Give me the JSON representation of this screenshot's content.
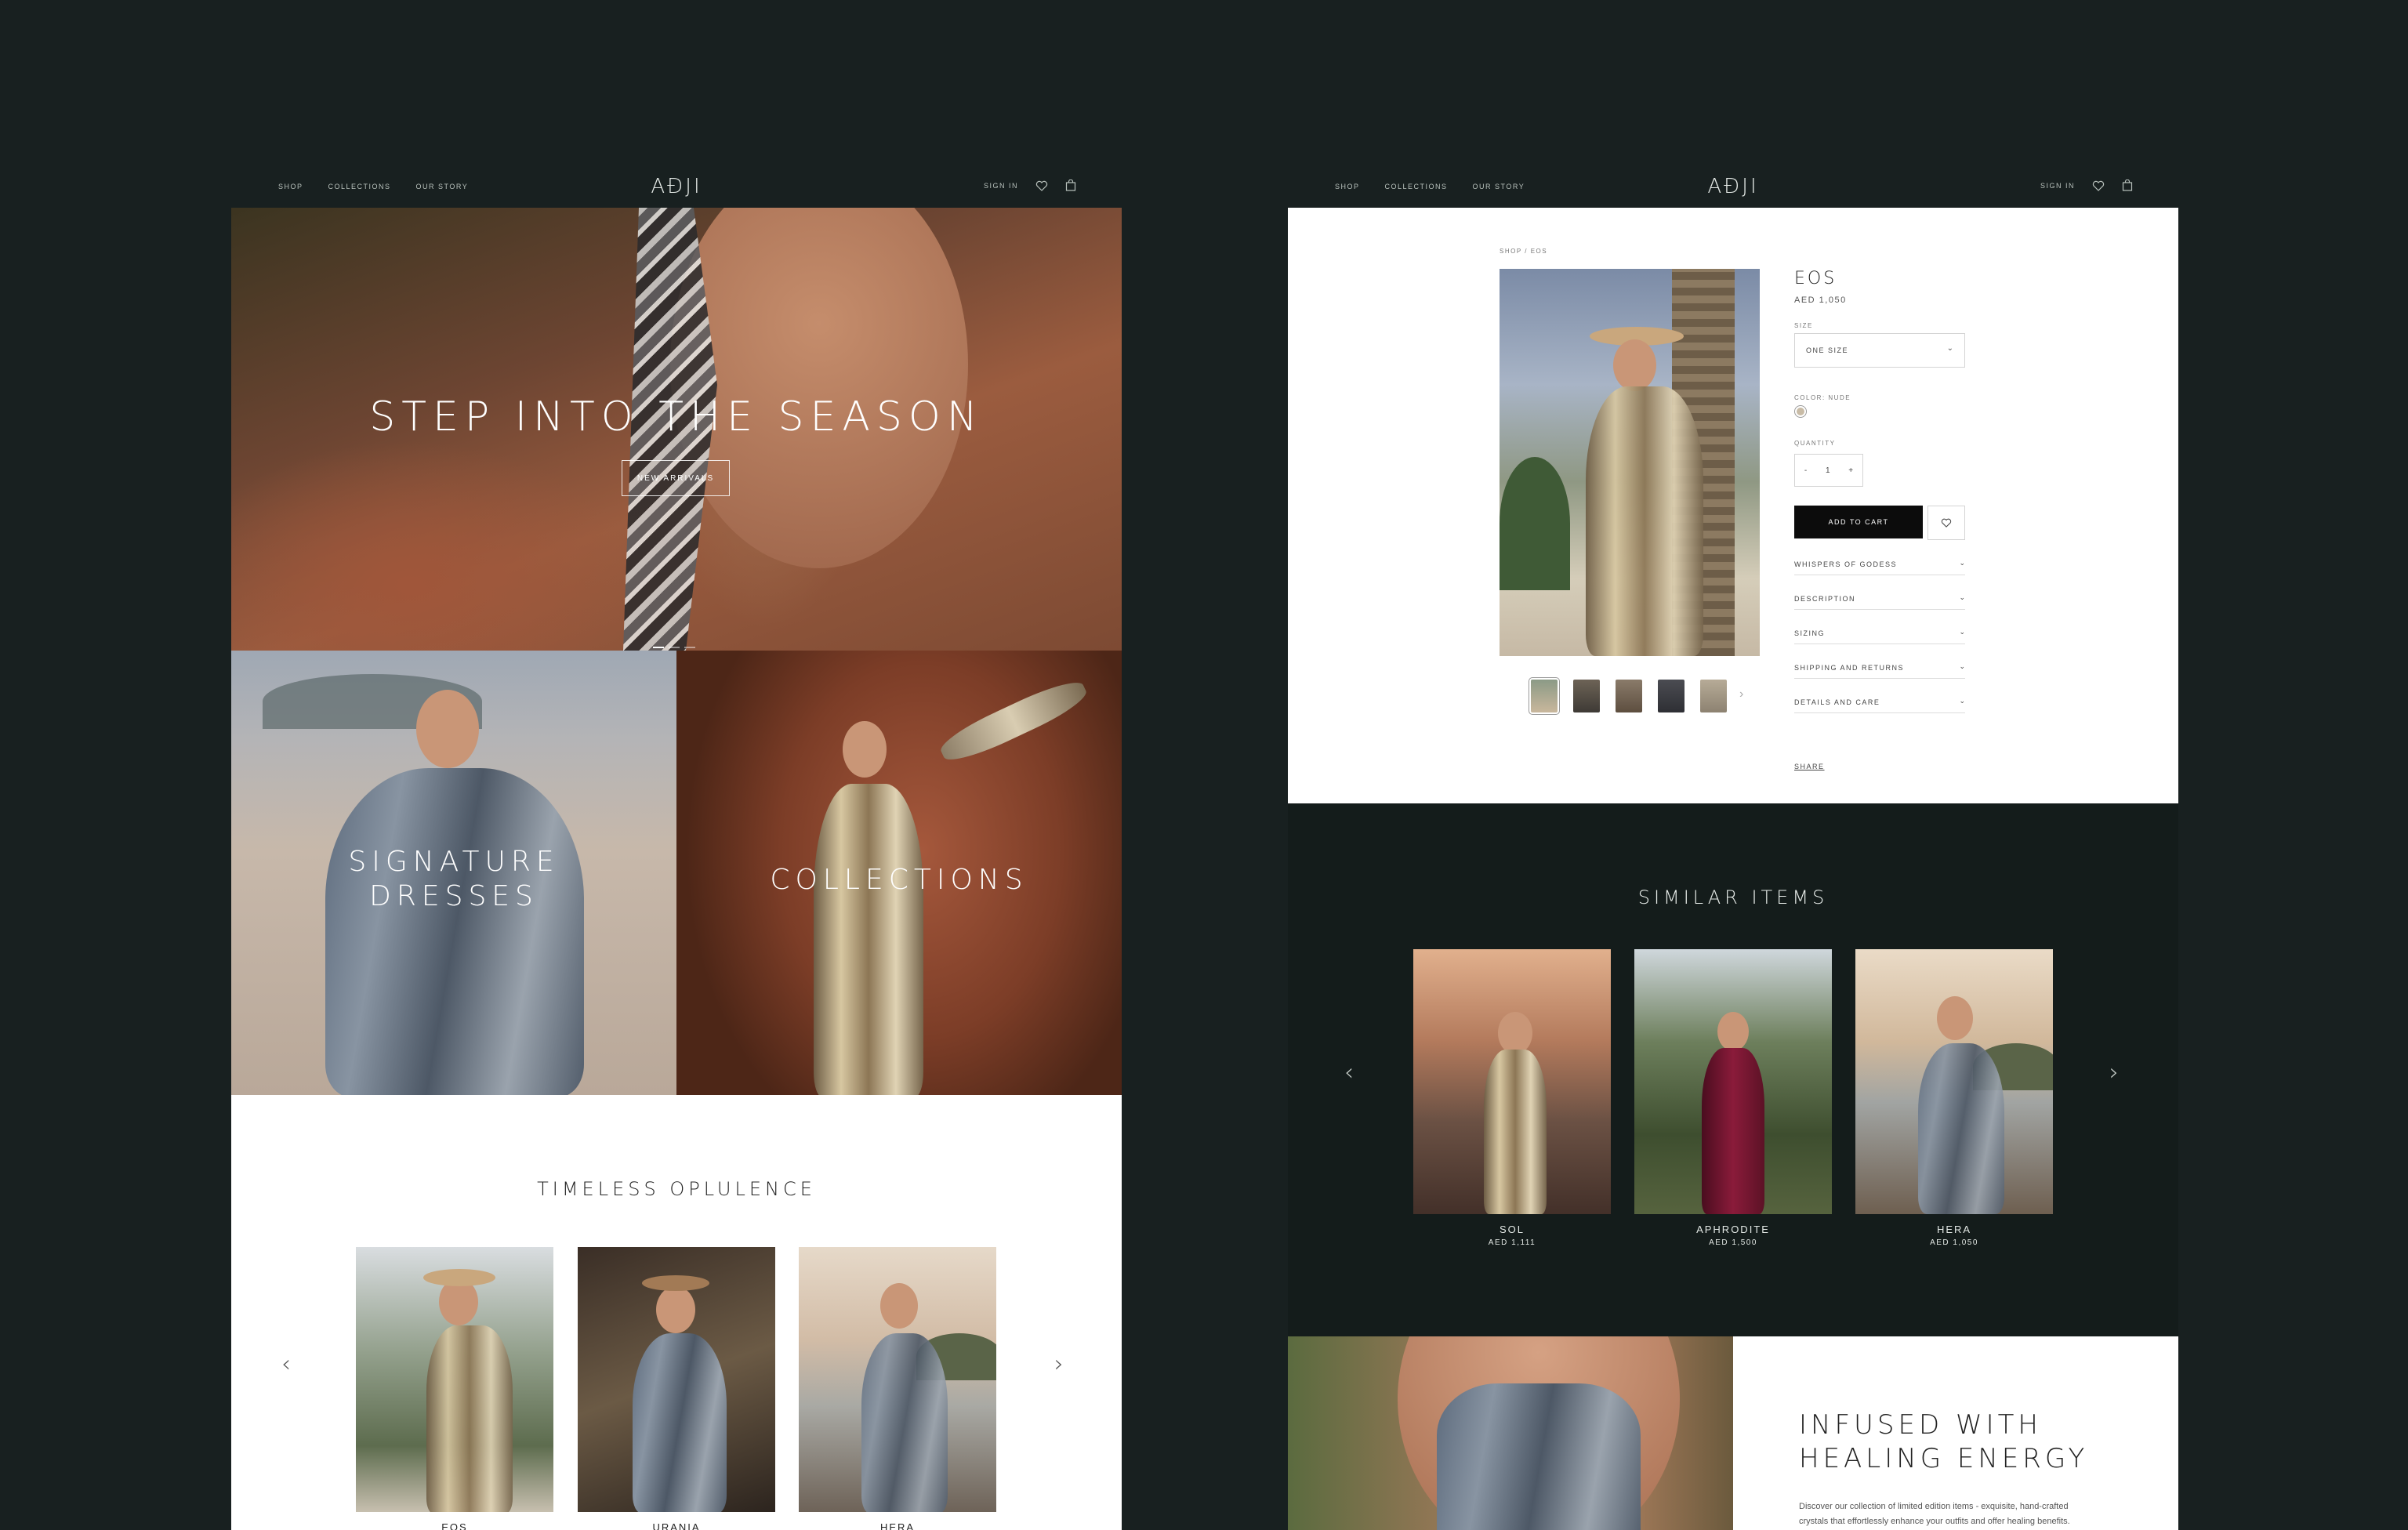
{
  "nav": {
    "links": [
      "SHOP",
      "COLLECTIONS",
      "OUR STORY"
    ],
    "logo": "AĐJI",
    "sign_in": "SIGN IN",
    "icons": [
      "heart-icon",
      "bag-icon"
    ]
  },
  "home": {
    "hero": {
      "title": "STEP INTO THE SEASON",
      "cta": "NEW ARRIVALS"
    },
    "tiles": [
      {
        "line1": "SIGNATURE",
        "line2": "DRESSES"
      },
      {
        "line1": "COLLECTIONS"
      }
    ],
    "section_title": "TIMELESS OPLULENCE",
    "products": [
      {
        "name": "EOS"
      },
      {
        "name": "URANIA"
      },
      {
        "name": "HERA"
      }
    ]
  },
  "product": {
    "breadcrumb": "SHOP / EOS",
    "name": "EOS",
    "price": "AED 1,050",
    "size_label": "SIZE",
    "size_value": "ONE SIZE",
    "color_label": "COLOR: NUDE",
    "quantity_label": "QUANTITY",
    "quantity_minus": "-",
    "quantity_value": "1",
    "quantity_plus": "+",
    "add_to_cart": "ADD TO CART",
    "accordions": [
      "WHISPERS OF GODESS",
      "DESCRIPTION",
      "SIZING",
      "SHIPPING AND RETURNS",
      "DETAILS AND CARE"
    ],
    "share": "SHARE",
    "colors": {
      "swatch": "#c8bba6"
    }
  },
  "similar": {
    "title": "SIMILAR ITEMS",
    "items": [
      {
        "name": "SOL",
        "price": "AED 1,111"
      },
      {
        "name": "APHRODITE",
        "price": "AED 1,500"
      },
      {
        "name": "HERA",
        "price": "AED 1,050"
      }
    ]
  },
  "healing": {
    "title_line1": "INFUSED WITH",
    "title_line2": "HEALING ENERGY",
    "body_line1": "Discover our collection of limited edition items - exquisite, hand-crafted",
    "body_line2": "crystals that effortlessly enhance your outfits and offer healing benefits."
  }
}
